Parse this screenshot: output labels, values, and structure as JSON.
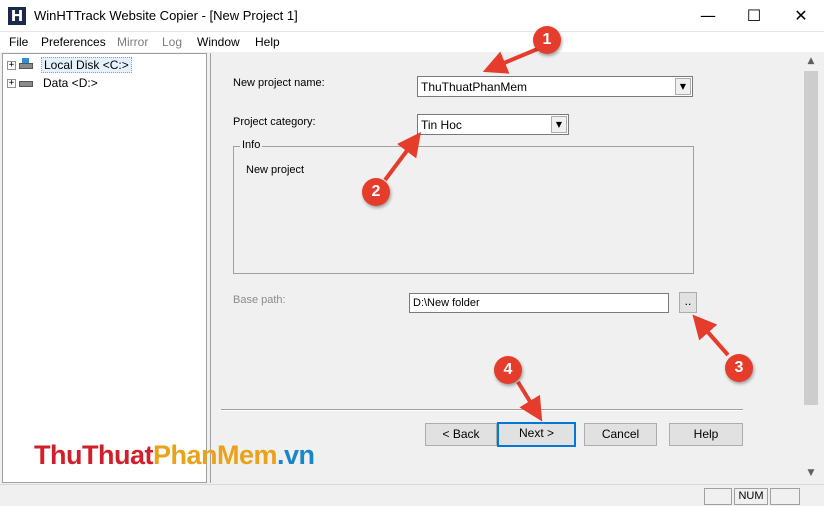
{
  "window": {
    "title": "WinHTTrack Website Copier - [New Project 1]",
    "app_icon_letter": "H",
    "minimize_glyph": "—",
    "maximize_glyph": "☐",
    "close_glyph": "✕"
  },
  "menu": {
    "items": [
      {
        "label": "File",
        "enabled": true
      },
      {
        "label": "Preferences",
        "enabled": true
      },
      {
        "label": "Mirror",
        "enabled": false
      },
      {
        "label": "Log",
        "enabled": false
      },
      {
        "label": "Window",
        "enabled": true
      },
      {
        "label": "Help",
        "enabled": true
      }
    ]
  },
  "tree": {
    "items": [
      {
        "label": "Local Disk <C:>",
        "selected": true,
        "icon": "windows-drive-icon"
      },
      {
        "label": "Data <D:>",
        "selected": false,
        "icon": "drive-icon"
      }
    ],
    "expander_glyph": "+"
  },
  "form": {
    "project_name_label": "New project name:",
    "project_name_value": "ThuThuatPhanMem",
    "project_category_label": "Project category:",
    "project_category_value": "Tin Hoc",
    "info_legend": "Info",
    "info_text": "New project",
    "base_path_label": "Base path:",
    "base_path_value": "D:\\New folder",
    "browse_label": "..",
    "dropdown_glyph": "▼"
  },
  "buttons": {
    "back": "< Back",
    "next": "Next >",
    "cancel": "Cancel",
    "help": "Help"
  },
  "scrollbar": {
    "up_glyph": "▲",
    "down_glyph": "▼"
  },
  "statusbar": {
    "num": "NUM"
  },
  "watermark": {
    "part1": "ThuThuat",
    "part2": "PhanMem",
    "part3": ".vn"
  },
  "annotations": {
    "badges": [
      "1",
      "2",
      "3",
      "4"
    ],
    "color": "#e53c2c"
  },
  "colors": {
    "accent": "#0078d7",
    "window_bg": "#f0f0f0"
  }
}
